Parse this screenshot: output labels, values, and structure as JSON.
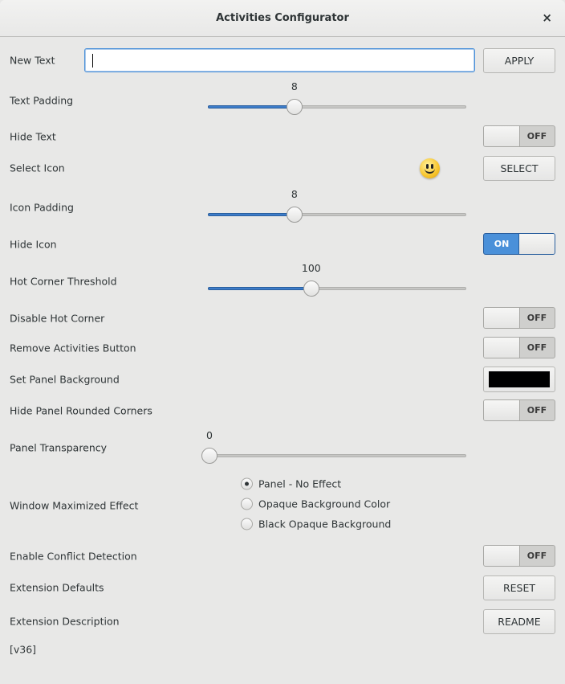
{
  "window": {
    "title": "Activities Configurator",
    "close_icon": "×"
  },
  "new_text": {
    "label": "New Text",
    "value": "",
    "apply": "APPLY"
  },
  "text_padding": {
    "label": "Text Padding",
    "value": "8",
    "fraction": 0.335
  },
  "hide_text": {
    "label": "Hide Text",
    "state": "OFF"
  },
  "select_icon": {
    "label": "Select Icon",
    "icon": "smiley-face-icon",
    "button": "SELECT"
  },
  "icon_padding": {
    "label": "Icon Padding",
    "value": "8",
    "fraction": 0.335
  },
  "hide_icon": {
    "label": "Hide Icon",
    "state": "ON"
  },
  "hot_corner_threshold": {
    "label": "Hot Corner Threshold",
    "value": "100",
    "fraction": 0.4
  },
  "disable_hot_corner": {
    "label": "Disable Hot Corner",
    "state": "OFF"
  },
  "remove_activities": {
    "label": "Remove Activities Button",
    "state": "OFF"
  },
  "panel_background": {
    "label": "Set Panel Background",
    "color": "#000000"
  },
  "hide_rounded": {
    "label": "Hide Panel Rounded Corners",
    "state": "OFF"
  },
  "panel_transparency": {
    "label": "Panel Transparency",
    "value": "0",
    "fraction": 0
  },
  "window_maximized": {
    "label": "Window Maximized Effect",
    "options": [
      "Panel - No Effect",
      "Opaque Background Color",
      "Black Opaque Background"
    ],
    "selected": 0
  },
  "conflict_detection": {
    "label": "Enable Conflict Detection",
    "state": "OFF"
  },
  "defaults": {
    "label": "Extension Defaults",
    "button": "RESET"
  },
  "description": {
    "label": "Extension Description",
    "button": "README"
  },
  "version": "[v36]",
  "colors": {
    "accent": "#4a90d9",
    "background": "#e8e8e7"
  }
}
